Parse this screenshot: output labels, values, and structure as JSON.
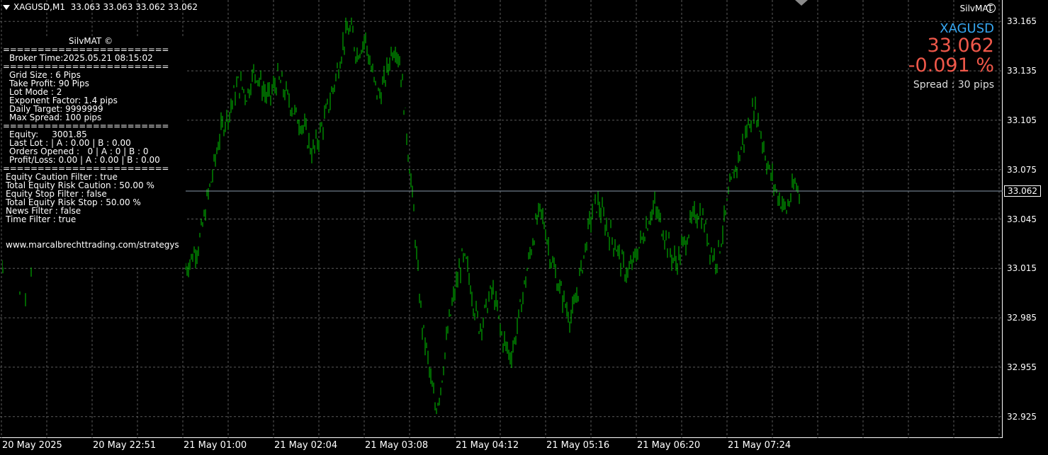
{
  "window": {
    "title": "XAGUSD,M1",
    "ohlc": "33.063 33.063 33.062 33.062",
    "ea_name": "SilvMAT"
  },
  "info": {
    "symbol": "XAGUSD",
    "price": "33.062",
    "change_pct": "-0.091 %",
    "spread": "Spread : 30 pips"
  },
  "panel": {
    "title": "SilvMAT ©",
    "separator": "========================",
    "broker_time": "Broker Time:2025.05.21 08:15:02",
    "grid_size": "Grid Size : 6 Pips",
    "take_profit": "Take Profit: 90 Pips",
    "lot_mode": "Lot Mode : 2",
    "exponent_factor": "Exponent Factor: 1.4 pips",
    "daily_target": "Daily Target: 9999999",
    "max_spread": "Max Spread: 100 pips",
    "equity": "Equity:     3001.85",
    "last_lot": "Last Lot : | A : 0.00 | B : 0.00",
    "orders_opened": "Orders Opened :   0 | A : 0 | B : 0",
    "profit_loss": "Profit/Loss: 0.00 | A : 0.00 | B : 0.00",
    "equity_caution_filter": "Equity Caution Filter : true",
    "total_equity_risk_caution": "Total Equity Risk Caution : 50.00 %",
    "equity_stop_filter": "Equity Stop Filter : false",
    "total_equity_risk_stop": "Total Equity Risk Stop : 50.00 %",
    "news_filter": "News Filter : false",
    "time_filter": "Time Filter : true",
    "website": "www.marcalbrechttrading.com/strategys"
  },
  "colors": {
    "background": "#000000",
    "bars": "#00c800",
    "grid": "#5a5a5a",
    "bid_line": "#8899aa",
    "symbol": "#36a6f0",
    "price": "#f0584a"
  },
  "chart_data": {
    "type": "ohlc-bars",
    "symbol": "XAGUSD",
    "timeframe": "M1",
    "grid": true,
    "ylim": [
      32.912,
      33.178
    ],
    "y_ticks": [
      "33.165",
      "33.135",
      "33.105",
      "33.075",
      "33.045",
      "33.015",
      "32.985",
      "32.955",
      "32.925"
    ],
    "x_ticks": [
      "20 May 2025",
      "20 May 22:51",
      "21 May 01:00",
      "21 May 02:04",
      "21 May 03:08",
      "21 May 04:12",
      "21 May 05:16",
      "21 May 06:20",
      "21 May 07:24"
    ],
    "current_price": 33.062,
    "series": [
      {
        "values": [
          33.015,
          33.02,
          33.025,
          33.03,
          33.042,
          33.058,
          33.07,
          33.085,
          33.098,
          33.105,
          33.11,
          33.12,
          33.127,
          33.125,
          33.12,
          33.13,
          33.135,
          33.128,
          33.122,
          33.118,
          33.124,
          33.13,
          33.126,
          33.12,
          33.115,
          33.108,
          33.105,
          33.1,
          33.092,
          33.085,
          33.092,
          33.1,
          33.108,
          33.118,
          33.128,
          33.14,
          33.152,
          33.16,
          33.158,
          33.145,
          33.15,
          33.155,
          33.14,
          33.128,
          33.12,
          33.125,
          33.135,
          33.148,
          33.15,
          33.138,
          33.11,
          33.08,
          33.05,
          33.01,
          32.98,
          32.965,
          32.945,
          32.93,
          32.94,
          32.96,
          32.98,
          32.995,
          33.008,
          33.02,
          33.018,
          33.005,
          32.99,
          32.98,
          32.985,
          32.995,
          33.002,
          32.99,
          32.975,
          32.968,
          32.962,
          32.97,
          32.985,
          33.0,
          33.015,
          33.03,
          33.042,
          33.05,
          33.04,
          33.025,
          33.015,
          33.005,
          32.998,
          32.99,
          32.985,
          32.995,
          33.01,
          33.025,
          33.04,
          33.052,
          33.055,
          33.048,
          33.04,
          33.035,
          33.03,
          33.022,
          33.015,
          33.012,
          33.018,
          33.025,
          33.032,
          33.04,
          33.048,
          33.052,
          33.045,
          33.038,
          33.03,
          33.022,
          33.018,
          33.025,
          33.032,
          33.04,
          33.046,
          33.05,
          33.045,
          33.035,
          33.025,
          33.02,
          33.03,
          33.045,
          33.06,
          33.072,
          33.08,
          33.09,
          33.098,
          33.108,
          33.112,
          33.1,
          33.088,
          33.075,
          33.068,
          33.06,
          33.055,
          33.05,
          33.058,
          33.066,
          33.062
        ]
      }
    ]
  }
}
